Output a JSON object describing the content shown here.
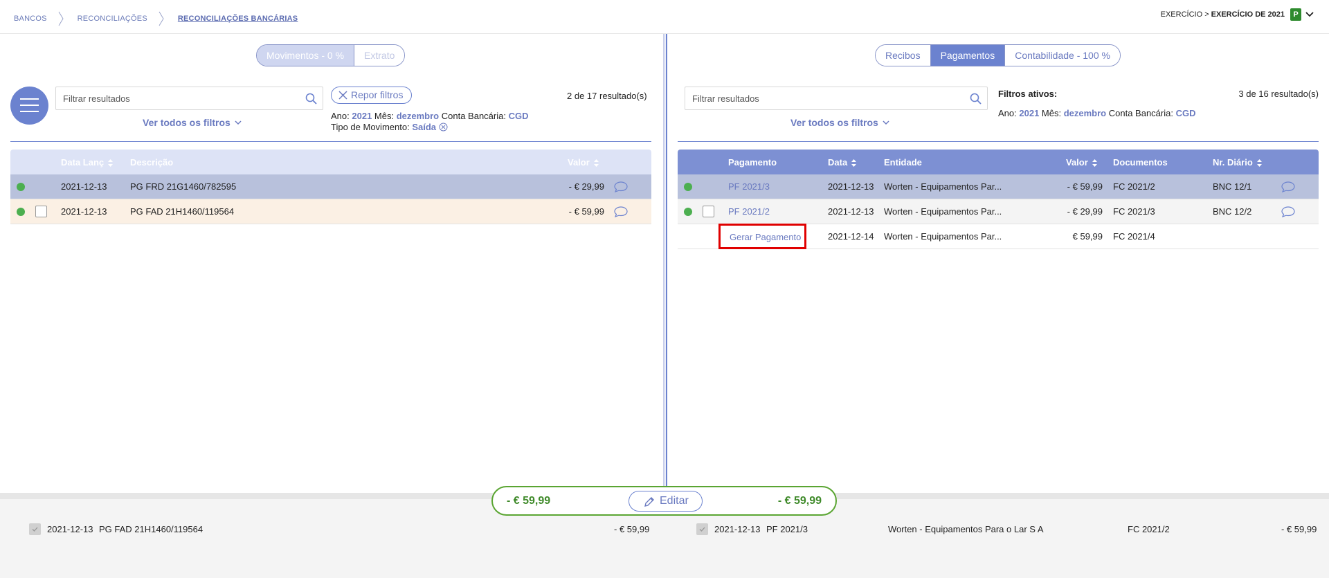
{
  "breadcrumb": [
    "BANCOS",
    "RECONCILIAÇÕES",
    "RECONCILIAÇÕES BANCÁRIAS"
  ],
  "exercise": {
    "label": "EXERCÍCIO >",
    "value": "EXERCÍCIO DE 2021",
    "badge": "P"
  },
  "left": {
    "tabs": [
      "Movimentos - 0 %",
      "Extrato"
    ],
    "search_placeholder": "Filtrar resultados",
    "reset_label": "Repor filtros",
    "results": "2 de 17 resultado(s)",
    "see_filters": "Ver todos os filtros",
    "filters": {
      "ano_label": "Ano:",
      "ano": "2021",
      "mes_label": "Mês:",
      "mes": "dezembro",
      "conta_label": "Conta Bancária:",
      "conta": "CGD",
      "tipo_label": "Tipo de Movimento:",
      "tipo": "Saída"
    },
    "columns": [
      "Data Lanç",
      "Descrição",
      "Valor"
    ],
    "rows": [
      {
        "date": "2021-12-13",
        "desc": "PG FRD 21G1460/782595",
        "value": "- € 29,99"
      },
      {
        "date": "2021-12-13",
        "desc": "PG FAD 21H1460/119564",
        "value": "- € 59,99"
      }
    ]
  },
  "right": {
    "tabs": [
      "Recibos",
      "Pagamentos",
      "Contabilidade - 100 %"
    ],
    "search_placeholder": "Filtrar resultados",
    "results": "3 de 16 resultado(s)",
    "active_filters_label": "Filtros ativos:",
    "see_filters": "Ver todos os filtros",
    "filters": {
      "ano_label": "Ano:",
      "ano": "2021",
      "mes_label": "Mês:",
      "mes": "dezembro",
      "conta_label": "Conta Bancária:",
      "conta": "CGD"
    },
    "columns": [
      "Pagamento",
      "Data",
      "Entidade",
      "Valor",
      "Documentos",
      "Nr. Diário"
    ],
    "rows": [
      {
        "pag": "PF 2021/3",
        "date": "2021-12-13",
        "ent": "Worten - Equipamentos Par...",
        "value": "- € 59,99",
        "doc": "FC 2021/2",
        "diario": "BNC 12/1"
      },
      {
        "pag": "PF 2021/2",
        "date": "2021-12-13",
        "ent": "Worten - Equipamentos Par...",
        "value": "- € 29,99",
        "doc": "FC 2021/3",
        "diario": "BNC 12/2"
      },
      {
        "pag": "Gerar Pagamento",
        "date": "2021-12-14",
        "ent": "Worten - Equipamentos Par...",
        "value": "€ 59,99",
        "doc": "FC 2021/4",
        "diario": ""
      }
    ]
  },
  "summary": {
    "left_amount": "- € 59,99",
    "right_amount": "- € 59,99",
    "edit_label": "Editar"
  },
  "bottom": {
    "left": {
      "date": "2021-12-13",
      "desc": "PG FAD 21H1460/119564",
      "value": "- € 59,99"
    },
    "right": {
      "date": "2021-12-13",
      "pag": "PF 2021/3",
      "ent": "Worten - Equipamentos Para o Lar S A",
      "doc": "FC 2021/2",
      "value": "- € 59,99"
    }
  },
  "colors": {
    "accent": "#6b82cf",
    "green": "#4caf50",
    "highlight": "#e00000"
  }
}
